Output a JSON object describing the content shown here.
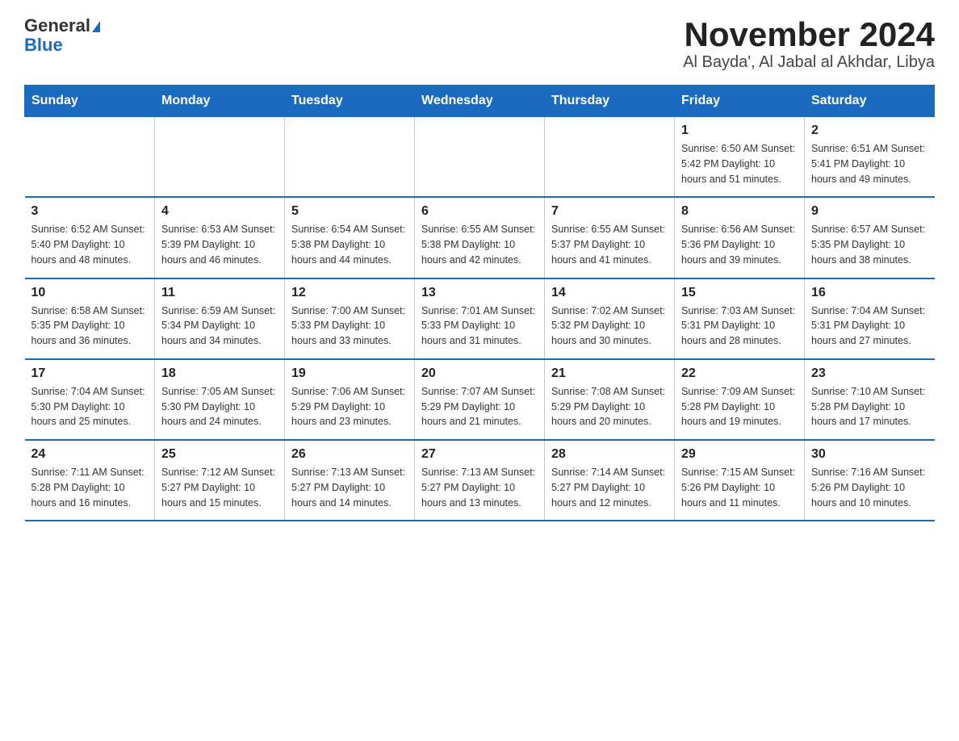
{
  "logo": {
    "general": "General",
    "blue": "Blue"
  },
  "title": "November 2024",
  "subtitle": "Al Bayda', Al Jabal al Akhdar, Libya",
  "weekdays": [
    "Sunday",
    "Monday",
    "Tuesday",
    "Wednesday",
    "Thursday",
    "Friday",
    "Saturday"
  ],
  "weeks": [
    [
      {
        "day": "",
        "info": ""
      },
      {
        "day": "",
        "info": ""
      },
      {
        "day": "",
        "info": ""
      },
      {
        "day": "",
        "info": ""
      },
      {
        "day": "",
        "info": ""
      },
      {
        "day": "1",
        "info": "Sunrise: 6:50 AM\nSunset: 5:42 PM\nDaylight: 10 hours and 51 minutes."
      },
      {
        "day": "2",
        "info": "Sunrise: 6:51 AM\nSunset: 5:41 PM\nDaylight: 10 hours and 49 minutes."
      }
    ],
    [
      {
        "day": "3",
        "info": "Sunrise: 6:52 AM\nSunset: 5:40 PM\nDaylight: 10 hours and 48 minutes."
      },
      {
        "day": "4",
        "info": "Sunrise: 6:53 AM\nSunset: 5:39 PM\nDaylight: 10 hours and 46 minutes."
      },
      {
        "day": "5",
        "info": "Sunrise: 6:54 AM\nSunset: 5:38 PM\nDaylight: 10 hours and 44 minutes."
      },
      {
        "day": "6",
        "info": "Sunrise: 6:55 AM\nSunset: 5:38 PM\nDaylight: 10 hours and 42 minutes."
      },
      {
        "day": "7",
        "info": "Sunrise: 6:55 AM\nSunset: 5:37 PM\nDaylight: 10 hours and 41 minutes."
      },
      {
        "day": "8",
        "info": "Sunrise: 6:56 AM\nSunset: 5:36 PM\nDaylight: 10 hours and 39 minutes."
      },
      {
        "day": "9",
        "info": "Sunrise: 6:57 AM\nSunset: 5:35 PM\nDaylight: 10 hours and 38 minutes."
      }
    ],
    [
      {
        "day": "10",
        "info": "Sunrise: 6:58 AM\nSunset: 5:35 PM\nDaylight: 10 hours and 36 minutes."
      },
      {
        "day": "11",
        "info": "Sunrise: 6:59 AM\nSunset: 5:34 PM\nDaylight: 10 hours and 34 minutes."
      },
      {
        "day": "12",
        "info": "Sunrise: 7:00 AM\nSunset: 5:33 PM\nDaylight: 10 hours and 33 minutes."
      },
      {
        "day": "13",
        "info": "Sunrise: 7:01 AM\nSunset: 5:33 PM\nDaylight: 10 hours and 31 minutes."
      },
      {
        "day": "14",
        "info": "Sunrise: 7:02 AM\nSunset: 5:32 PM\nDaylight: 10 hours and 30 minutes."
      },
      {
        "day": "15",
        "info": "Sunrise: 7:03 AM\nSunset: 5:31 PM\nDaylight: 10 hours and 28 minutes."
      },
      {
        "day": "16",
        "info": "Sunrise: 7:04 AM\nSunset: 5:31 PM\nDaylight: 10 hours and 27 minutes."
      }
    ],
    [
      {
        "day": "17",
        "info": "Sunrise: 7:04 AM\nSunset: 5:30 PM\nDaylight: 10 hours and 25 minutes."
      },
      {
        "day": "18",
        "info": "Sunrise: 7:05 AM\nSunset: 5:30 PM\nDaylight: 10 hours and 24 minutes."
      },
      {
        "day": "19",
        "info": "Sunrise: 7:06 AM\nSunset: 5:29 PM\nDaylight: 10 hours and 23 minutes."
      },
      {
        "day": "20",
        "info": "Sunrise: 7:07 AM\nSunset: 5:29 PM\nDaylight: 10 hours and 21 minutes."
      },
      {
        "day": "21",
        "info": "Sunrise: 7:08 AM\nSunset: 5:29 PM\nDaylight: 10 hours and 20 minutes."
      },
      {
        "day": "22",
        "info": "Sunrise: 7:09 AM\nSunset: 5:28 PM\nDaylight: 10 hours and 19 minutes."
      },
      {
        "day": "23",
        "info": "Sunrise: 7:10 AM\nSunset: 5:28 PM\nDaylight: 10 hours and 17 minutes."
      }
    ],
    [
      {
        "day": "24",
        "info": "Sunrise: 7:11 AM\nSunset: 5:28 PM\nDaylight: 10 hours and 16 minutes."
      },
      {
        "day": "25",
        "info": "Sunrise: 7:12 AM\nSunset: 5:27 PM\nDaylight: 10 hours and 15 minutes."
      },
      {
        "day": "26",
        "info": "Sunrise: 7:13 AM\nSunset: 5:27 PM\nDaylight: 10 hours and 14 minutes."
      },
      {
        "day": "27",
        "info": "Sunrise: 7:13 AM\nSunset: 5:27 PM\nDaylight: 10 hours and 13 minutes."
      },
      {
        "day": "28",
        "info": "Sunrise: 7:14 AM\nSunset: 5:27 PM\nDaylight: 10 hours and 12 minutes."
      },
      {
        "day": "29",
        "info": "Sunrise: 7:15 AM\nSunset: 5:26 PM\nDaylight: 10 hours and 11 minutes."
      },
      {
        "day": "30",
        "info": "Sunrise: 7:16 AM\nSunset: 5:26 PM\nDaylight: 10 hours and 10 minutes."
      }
    ]
  ]
}
